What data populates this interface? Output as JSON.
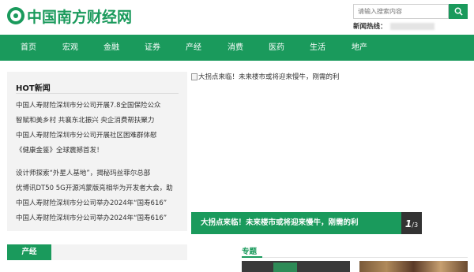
{
  "header": {
    "logo_text": "中国南方财经网",
    "search_placeholder": "请输入搜索内容",
    "hotline_label": "新闻热线："
  },
  "nav": {
    "items": [
      {
        "label": "首页"
      },
      {
        "label": "宏观"
      },
      {
        "label": "金融"
      },
      {
        "label": "证券"
      },
      {
        "label": "产经"
      },
      {
        "label": "消费"
      },
      {
        "label": "医药"
      },
      {
        "label": "生活"
      },
      {
        "label": "地产"
      }
    ]
  },
  "hot_news": {
    "title": "HOT新闻",
    "items": [
      "中国人寿财险深圳市分公司开展7.8全国保险公众",
      "智赋和美乡村 共襄东北振兴 央企消费帮扶聚力",
      "中国人寿财险深圳市分公司开展社区困难群体慰",
      "《健康金鉴》全球震撼首发！",
      "设计师探索“外星人基地”，揭秘玛丝菲尔总部",
      "优博讯DT50 5G开源鸿蒙版亮相华为开发者大会，助",
      "中国人寿财险深圳市分公司举办2024年“国寿616”",
      "中国人寿财险深圳市分公司举办2024年“国寿616”"
    ]
  },
  "slider": {
    "image_alt": "大拐点来临！未来楼市或将迎来慢牛，刚需的利",
    "caption": "大拐点来临！未来楼市或将迎来慢牛，刚需的利",
    "current": "1",
    "total": "/3"
  },
  "sections": {
    "left_tag": "产经",
    "topic_title": "专题"
  },
  "colors": {
    "brand_green": "#1a9a5c",
    "panel_gray": "#f3f3f3",
    "counter_dark": "#333333"
  },
  "icons": {
    "search": "search-icon",
    "broken_image": "broken-image-icon"
  }
}
